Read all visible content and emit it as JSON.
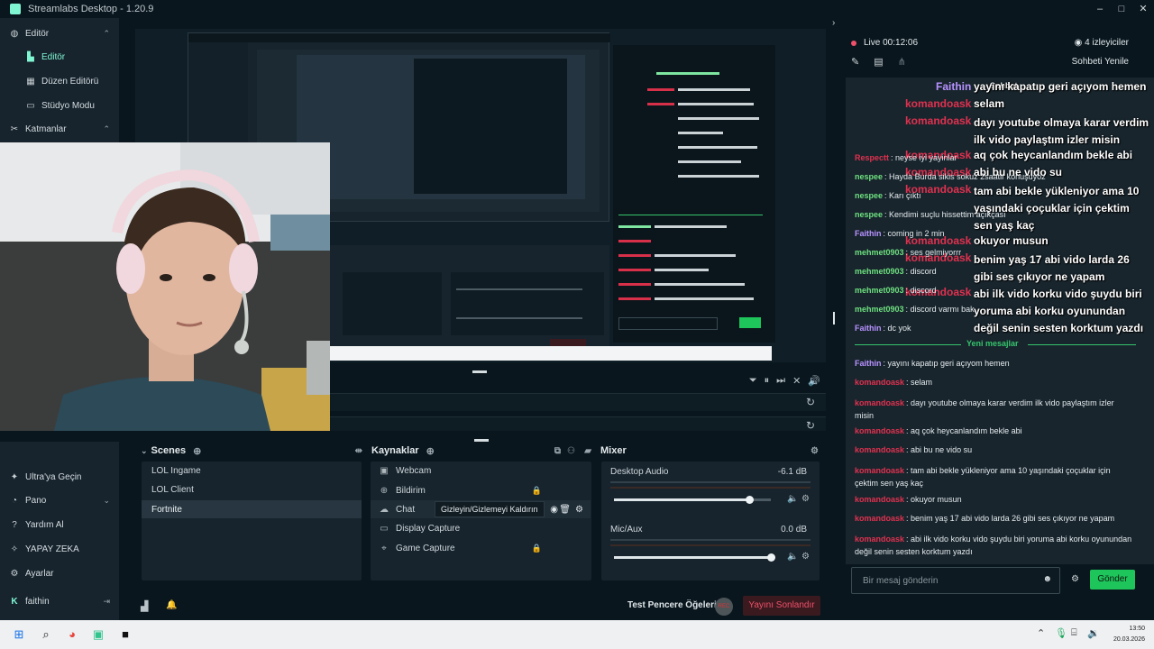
{
  "app": {
    "title": "Streamlabs Desktop - 1.20.9",
    "window_controls": [
      "–",
      "□",
      "✕"
    ]
  },
  "nav": {
    "editor_section": "Editör",
    "editor": "Editör",
    "layout_editor": "Düzen Editörü",
    "studio_mode": "Stüdyo Modu",
    "layers": "Katmanlar",
    "ultra": "Ultra'ya Geçin",
    "dashboard": "Pano",
    "help_ai": "Yardım Al",
    "ai": "YAPAY ZEKA",
    "settings": "Ayarlar",
    "user": "faithin"
  },
  "scenes": {
    "header": "Scenes",
    "items": [
      "LOL Ingame",
      "LOL Client",
      "Fortnite"
    ]
  },
  "sources": {
    "header": "Kaynaklar",
    "items": [
      "Webcam",
      "Bildirim",
      "Chat",
      "Display Capture",
      "Game Capture"
    ],
    "tooltip": "Gizleyin/Gizlemeyi Kaldırın"
  },
  "mixer": {
    "header": "Mixer",
    "channels": [
      {
        "name": "Desktop Audio",
        "db": "-6.1 dB",
        "level": 0.86
      },
      {
        "name": "Mic/Aux",
        "db": "0.0 dB",
        "level": 1.0
      }
    ]
  },
  "footer": {
    "test_label": "Test Pencere Öğeleri",
    "rec": "REC",
    "end_stream": "Yayını Sonlandır"
  },
  "chat": {
    "live_label": "Live 00:12:06",
    "viewers": "4 izleyiciler",
    "refresh": "Sohbeti Yenile",
    "new_messages": "Yeni mesajlar",
    "input_placeholder": "Bir mesaj gönderin",
    "send": "Gönder",
    "overlay_title": "Sohbet",
    "overlay_top_lines": [
      {
        "user": "Faithin",
        "text": "yayını kapatıp geri açıyom hemen"
      },
      {
        "user": "komandoask",
        "text": "selam"
      },
      {
        "user": "komandoask",
        "text": "dayı youtube olmaya karar verdim ilk vido paylaştım izler misin"
      },
      {
        "user": "komandoask",
        "text": "aq çok heycanlandım bekle abi"
      },
      {
        "user": "komandoask",
        "text": "abi bu ne vido su"
      },
      {
        "user": "komandoask",
        "text": "tam abi bekle yükleniyor ama 10 yaşındaki çoçuklar için çektim sen yaş kaç"
      },
      {
        "user": "komandoask",
        "text": "okuyor musun"
      },
      {
        "user": "komandoask",
        "text": "benim yaş 17 abi vido larda 26 gibi ses çıkıyor ne yapam"
      },
      {
        "user": "komandoask",
        "text": "abi ilk vido korku vido şuydu biri yoruma abi korku oyunundan değil senin sesten korktum yazdı"
      }
    ],
    "old_messages": [
      {
        "user": "Respectt",
        "text": "neyse iyi yayinlar",
        "color": "#e0314f"
      },
      {
        "user": "nespee",
        "text": "Hayda Burda sikis sokuz 2saatir konuşuyoz",
        "color": "#6ee07f"
      },
      {
        "user": "nespee",
        "text": "Karı çıktı",
        "color": "#6ee07f"
      },
      {
        "user": "nespee",
        "text": "Kendimi suçlu hissettim açıkçası",
        "color": "#6ee07f"
      },
      {
        "user": "Faithin",
        "text": "coming in 2 min",
        "color": "#b892ff"
      },
      {
        "user": "mehmet0903",
        "text": "ses gelmiyorrr",
        "color": "#6ee07f"
      },
      {
        "user": "mehmet0903",
        "text": "discord",
        "color": "#6ee07f"
      },
      {
        "user": "mehmet0903",
        "text": "discord",
        "color": "#6ee07f"
      },
      {
        "user": "mehmet0903",
        "text": "discord varmı bak",
        "color": "#6ee07f"
      },
      {
        "user": "Faithin",
        "text": "dc yok",
        "color": "#b892ff"
      }
    ],
    "new_list": [
      {
        "user": "Faithin",
        "text": "yayını kapatıp geri açıyom hemen",
        "color": "#b892ff"
      },
      {
        "user": "komandoask",
        "text": "selam",
        "color": "#e0314f"
      },
      {
        "user": "komandoask",
        "text": "dayı youtube olmaya karar verdim ilk vido paylaştım izler misin",
        "color": "#e0314f"
      },
      {
        "user": "komandoask",
        "text": "aq çok heycanlandım bekle abi",
        "color": "#e0314f"
      },
      {
        "user": "komandoask",
        "text": "abi bu ne vido su",
        "color": "#e0314f"
      },
      {
        "user": "komandoask",
        "text": "tam abi bekle yükleniyor ama 10 yaşındaki çoçuklar için çektim sen yaş kaç",
        "color": "#e0314f"
      },
      {
        "user": "komandoask",
        "text": "okuyor musun",
        "color": "#e0314f"
      },
      {
        "user": "komandoask",
        "text": "benim yaş 17 abi vido larda 26 gibi ses çıkıyor ne yapam",
        "color": "#e0314f"
      },
      {
        "user": "komandoask",
        "text": "abi ilk vido korku vido şuydu biri yoruma abi korku oyunundan değil senin sesten korktum yazdı",
        "color": "#e0314f"
      }
    ]
  },
  "taskbar": {
    "time": "13:50",
    "date": "20.03.2026"
  },
  "colors": {
    "accent": "#80f5d2",
    "send_green": "#1ec55b",
    "danger": "#f0506a"
  }
}
